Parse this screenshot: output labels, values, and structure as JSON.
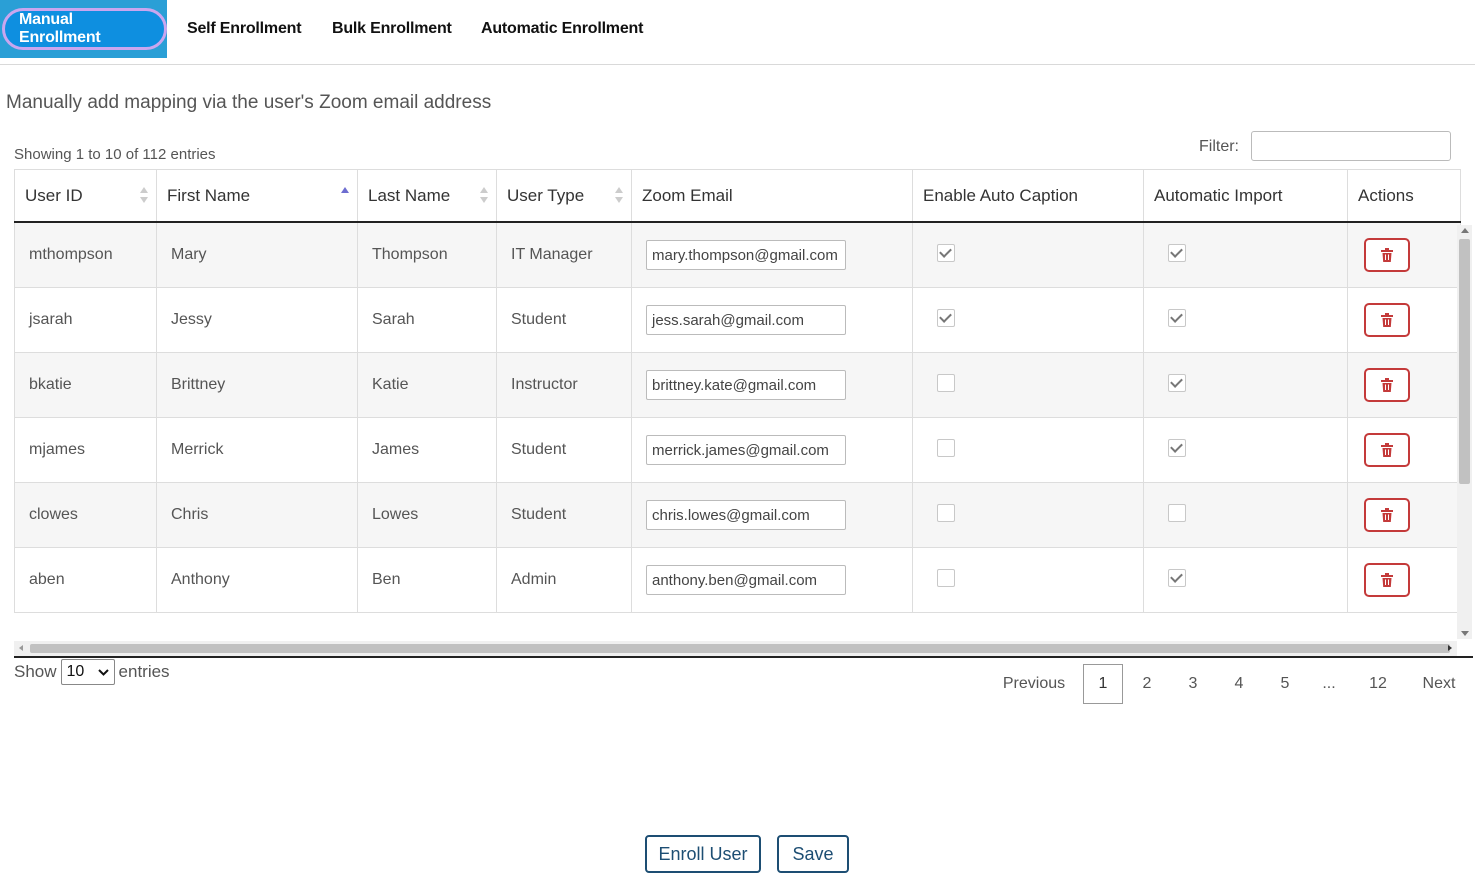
{
  "tabs": [
    {
      "label": "Manual Enrollment"
    },
    {
      "label": "Self Enrollment"
    },
    {
      "label": "Bulk Enrollment"
    },
    {
      "label": "Automatic Enrollment"
    }
  ],
  "description": "Manually add mapping via the user's Zoom email address",
  "showing": "Showing 1 to 10 of 112 entries",
  "filter": {
    "label": "Filter:",
    "value": ""
  },
  "columns": [
    "User ID",
    "First Name",
    "Last Name",
    "User Type",
    "Zoom Email",
    "Enable Auto Caption",
    "Automatic Import",
    "Actions"
  ],
  "rows": [
    {
      "user_id": "mthompson",
      "first": "Mary",
      "last": "Thompson",
      "type": "IT Manager",
      "email": "mary.thompson@gmail.com",
      "caption": true,
      "import": true
    },
    {
      "user_id": "jsarah",
      "first": "Jessy",
      "last": "Sarah",
      "type": "Student",
      "email": "jess.sarah@gmail.com",
      "caption": true,
      "import": true
    },
    {
      "user_id": "bkatie",
      "first": "Brittney",
      "last": "Katie",
      "type": "Instructor",
      "email": "brittney.kate@gmail.com",
      "caption": false,
      "import": true
    },
    {
      "user_id": "mjames",
      "first": "Merrick",
      "last": "James",
      "type": "Student",
      "email": "merrick.james@gmail.com",
      "caption": false,
      "import": true
    },
    {
      "user_id": "clowes",
      "first": "Chris",
      "last": "Lowes",
      "type": "Student",
      "email": "chris.lowes@gmail.com",
      "caption": false,
      "import": false
    },
    {
      "user_id": "aben",
      "first": "Anthony",
      "last": "Ben",
      "type": "Admin",
      "email": "anthony.ben@gmail.com",
      "caption": false,
      "import": true
    }
  ],
  "show": {
    "prefix": "Show",
    "value": "10",
    "suffix": "entries"
  },
  "pagination": {
    "previous": "Previous",
    "pages": [
      "1",
      "2",
      "3",
      "4",
      "5",
      "...",
      "12"
    ],
    "current": "1",
    "next": "Next"
  },
  "buttons": {
    "enroll": "Enroll User",
    "save": "Save"
  },
  "colors": {
    "tab_active": "#0e8fe0",
    "delete": "#c43a3a",
    "button": "#1d4e73"
  }
}
